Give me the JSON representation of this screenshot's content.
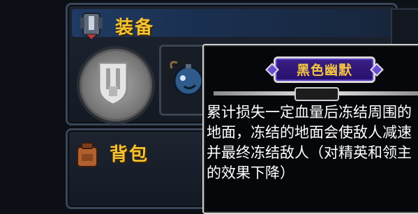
{
  "equipment_panel": {
    "title": "装备",
    "emblem_icon": "shield-helmet-icon",
    "slot_1_icon": "shield-icon",
    "slot_2_icon": "bomb-icon"
  },
  "backpack_panel": {
    "title": "背包",
    "icon": "backpack-icon"
  },
  "tooltip": {
    "item_name": "黑色幽默",
    "description": "累计损失一定血量后冻结周围的地面，冻结的地面会使敌人减速并最终冻结敌人（对精英和领主的效果下降）",
    "colors": {
      "name_text": "#f6c640",
      "name_bg": "#2e1577",
      "desc_text": "#ffffff"
    }
  },
  "colors": {
    "panel_title": "#f5c233",
    "panel_header": "#1f3b63"
  }
}
